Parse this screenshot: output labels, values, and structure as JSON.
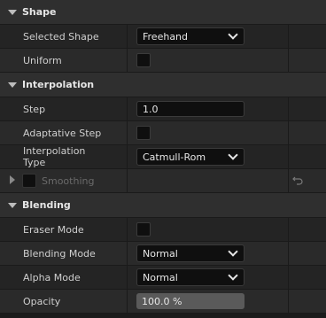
{
  "sections": {
    "shape": {
      "title": "Shape",
      "selected_shape_label": "Selected Shape",
      "selected_shape_value": "Freehand",
      "uniform_label": "Uniform",
      "uniform_checked": false
    },
    "interpolation": {
      "title": "Interpolation",
      "step_label": "Step",
      "step_value": "1.0",
      "adaptative_step_label": "Adaptative Step",
      "adaptative_step_checked": false,
      "interpolation_type_label": "Interpolation Type",
      "interpolation_type_value": "Catmull-Rom",
      "smoothing_label": "Smoothing",
      "smoothing_enabled": false
    },
    "blending": {
      "title": "Blending",
      "eraser_mode_label": "Eraser Mode",
      "eraser_mode_checked": false,
      "blending_mode_label": "Blending Mode",
      "blending_mode_value": "Normal",
      "alpha_mode_label": "Alpha Mode",
      "alpha_mode_value": "Normal",
      "opacity_label": "Opacity",
      "opacity_value": "100.0 %",
      "opacity_fraction": 1.0
    }
  },
  "icons": {
    "expand": "triangle-down-icon",
    "collapsed": "triangle-right-icon",
    "dropdown": "chevron-down-icon",
    "reset": "reset-arrow-icon"
  },
  "colors": {
    "background": "#1b1b1b",
    "header": "#2f2f2f",
    "row": "#242424",
    "row_alt": "#2a2a2a",
    "field": "#0f0f0f",
    "text": "#cfcfcf",
    "disabled_text": "#6a6a6a"
  }
}
